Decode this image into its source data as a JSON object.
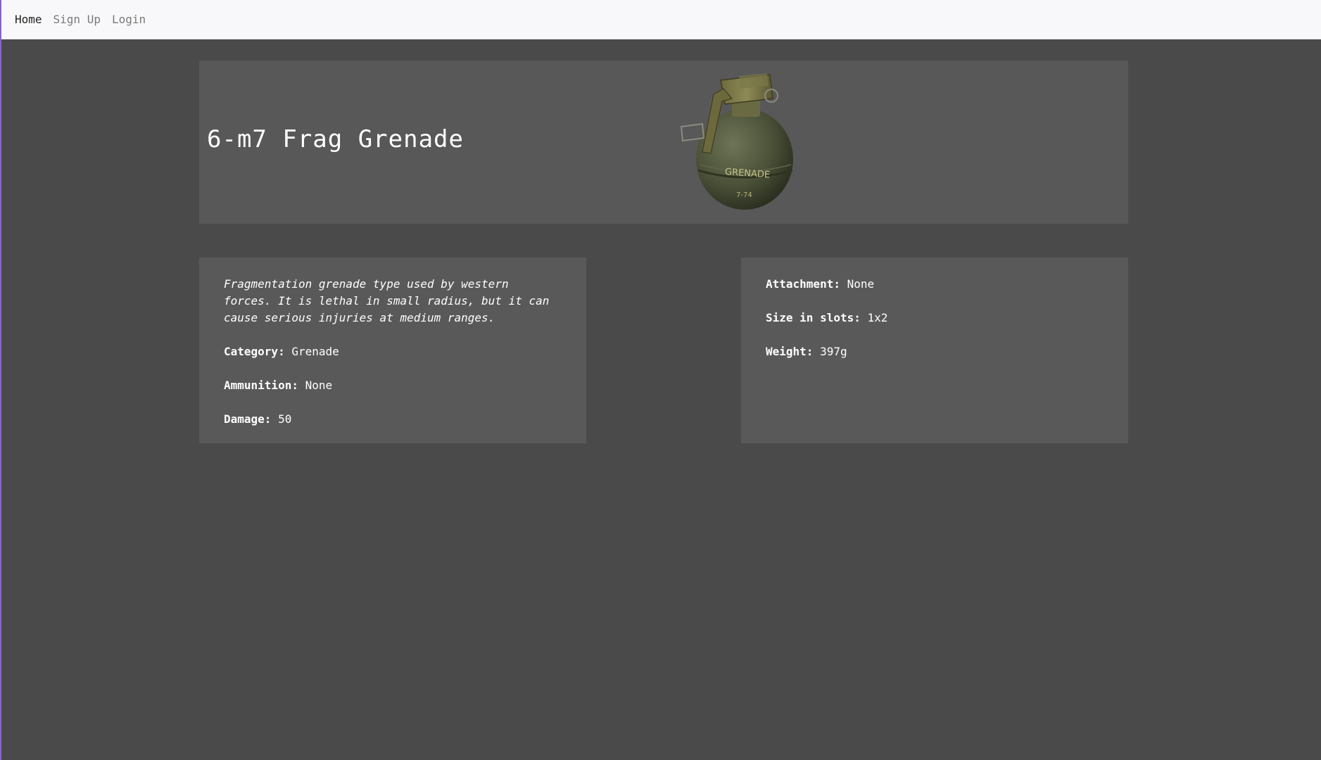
{
  "nav": {
    "items": [
      {
        "label": "Home"
      },
      {
        "label": "Sign Up"
      },
      {
        "label": "Login"
      }
    ]
  },
  "item": {
    "name": "6-m7 Frag Grenade",
    "image_label": "GRENADE",
    "image_code": "7-74",
    "description": "Fragmentation grenade type used by western forces. It is lethal in small radius, but it can cause serious injuries at medium ranges.",
    "category_label": "Category:",
    "category": "Grenade",
    "ammunition_label": "Ammunition:",
    "ammunition": "None",
    "damage_label": "Damage:",
    "damage": "50",
    "attachment_label": "Attachment:",
    "attachment": "None",
    "size_label": "Size in slots:",
    "size": "1x2",
    "weight_label": "Weight:",
    "weight": "397g"
  },
  "colors": {
    "page_background": "#4a4a4a",
    "card_background": "#595959",
    "navbar_background": "#f8f8fa",
    "grenade_body": "#4b5138"
  }
}
